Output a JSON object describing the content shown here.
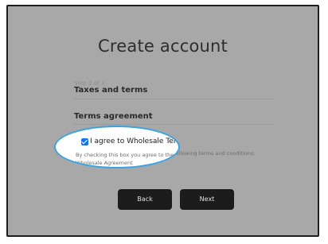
{
  "page": {
    "title": "Create account",
    "step": "Step 2 of 3",
    "section_title": "Taxes and terms",
    "terms_title": "Terms agreement"
  },
  "agreement": {
    "checkbox_checked": true,
    "label": "I agree to Wholesale Terms*",
    "description": "By checking this box you agree to the following terms and conditions:",
    "link_text": "Wholesale Agreement"
  },
  "buttons": {
    "back": "Back",
    "next": "Next"
  },
  "colors": {
    "overlay_bg": "#a8a8a8",
    "highlight_border": "#3aa3e3",
    "checkbox": "#1a73e8",
    "button_bg": "#1c1c1c"
  }
}
